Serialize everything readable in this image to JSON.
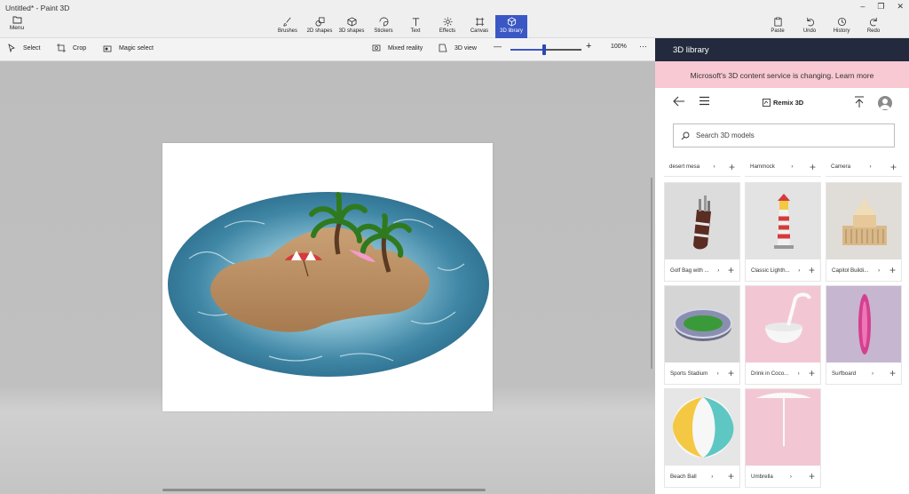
{
  "window": {
    "title": "Untitled* - Paint 3D",
    "controls": [
      "–",
      "❐",
      "✕"
    ]
  },
  "menu": {
    "label": "Menu"
  },
  "tools": [
    {
      "label": "Brushes",
      "icon": "brush-icon"
    },
    {
      "label": "2D shapes",
      "icon": "2d-shapes-icon"
    },
    {
      "label": "3D shapes",
      "icon": "3d-shapes-icon"
    },
    {
      "label": "Stickers",
      "icon": "stickers-icon"
    },
    {
      "label": "Text",
      "icon": "text-icon"
    },
    {
      "label": "Effects",
      "icon": "effects-icon"
    },
    {
      "label": "Canvas",
      "icon": "canvas-icon"
    },
    {
      "label": "3D library",
      "icon": "3d-library-icon",
      "active": true
    }
  ],
  "right_tools": [
    {
      "label": "Paste",
      "icon": "paste-icon"
    },
    {
      "label": "Undo",
      "icon": "undo-icon"
    },
    {
      "label": "History",
      "icon": "history-icon"
    },
    {
      "label": "Redo",
      "icon": "redo-icon"
    }
  ],
  "toolbar": {
    "select": "Select",
    "crop": "Crop",
    "magic_select": "Magic select",
    "mixed_reality": "Mixed reality",
    "view_3d": "3D view",
    "zoom_minus": "—",
    "zoom_plus": "+",
    "zoom_level": "100%",
    "zoom_fraction": 0.48,
    "more": "···"
  },
  "library": {
    "header": "3D library",
    "banner_text": "Microsoft's 3D content service is changing.",
    "banner_link": "Learn more",
    "remix_label": "Remix 3D",
    "search_placeholder": "Search 3D models",
    "partial_row": [
      {
        "label": "desert mesa"
      },
      {
        "label": "Hammock"
      },
      {
        "label": "Camera"
      }
    ],
    "items": [
      {
        "label": "Golf Bag with ...",
        "icon": "golf-bag-thumbnail"
      },
      {
        "label": "Classic Lighth...",
        "icon": "lighthouse-thumbnail"
      },
      {
        "label": "Capitol Buildi...",
        "icon": "capitol-thumbnail"
      },
      {
        "label": "Sports Stadium",
        "icon": "stadium-thumbnail"
      },
      {
        "label": "Drink in Coco...",
        "icon": "coconut-drink-thumbnail"
      },
      {
        "label": "Surfboard",
        "icon": "surfboard-thumbnail"
      },
      {
        "label": "Beach Ball",
        "icon": "beach-ball-thumbnail"
      },
      {
        "label": "Umbrella",
        "icon": "umbrella-thumbnail"
      }
    ],
    "chevron": "›",
    "plus": "+"
  },
  "colors": {
    "accent": "#3a57c4",
    "library_header": "#232a3d",
    "banner": "#f8c9d2"
  }
}
